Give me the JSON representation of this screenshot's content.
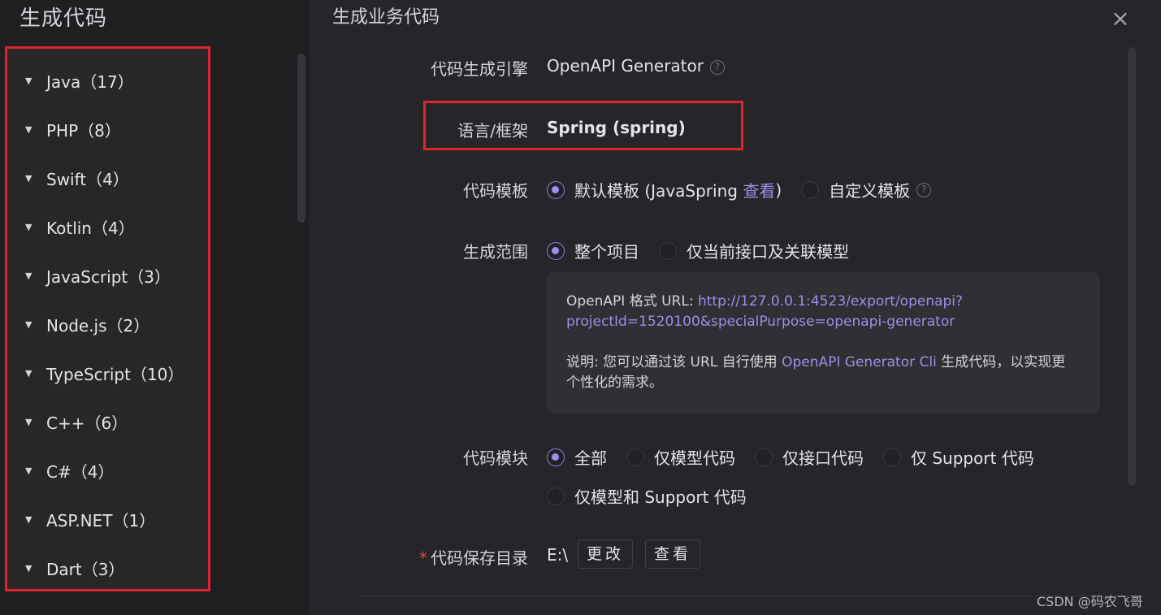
{
  "left_panel": {
    "title": "生成代码",
    "languages": [
      {
        "label": "Java（17）"
      },
      {
        "label": "PHP（8）"
      },
      {
        "label": "Swift（4）"
      },
      {
        "label": "Kotlin（4）"
      },
      {
        "label": "JavaScript（3）"
      },
      {
        "label": "Node.js（2）"
      },
      {
        "label": "TypeScript（10）"
      },
      {
        "label": "C++（6）"
      },
      {
        "label": "C#（4）"
      },
      {
        "label": "ASP.NET（1）"
      },
      {
        "label": "Dart（3）"
      }
    ]
  },
  "dialog": {
    "title": "生成业务代码",
    "close_symbol": "×",
    "engine": {
      "label": "代码生成引擎",
      "value": "OpenAPI Generator",
      "help": "?"
    },
    "language": {
      "label": "语言/框架",
      "value": "Spring (spring)"
    },
    "template": {
      "label": "代码模板",
      "option_default_prefix": "默认模板 (JavaSpring ",
      "option_default_link": "查看",
      "option_default_suffix": ")",
      "option_custom": "自定义模板",
      "selected": "default"
    },
    "scope": {
      "label": "生成范围",
      "option_project": "整个项目",
      "option_current": "仅当前接口及关联模型",
      "selected": "project"
    },
    "info": {
      "url_label": "OpenAPI 格式 URL: ",
      "url": "http://127.0.0.1:4523/export/openapi?projectId=1520100&specialPurpose=openapi-generator",
      "url_line1": "http://127.0.0.1:4523/export/openapi?",
      "url_line2": "projectId=1520100&specialPurpose=openapi-generator",
      "note_prefix": "说明: 您可以通过该 URL 自行使用 ",
      "note_link": "OpenAPI Generator Cli",
      "note_suffix_line1": " 生成代码，以实现更",
      "note_line2": "个性化的需求。"
    },
    "module": {
      "label": "代码模块",
      "option_all": "全部",
      "option_model": "仅模型代码",
      "option_api": "仅接口代码",
      "option_support": "仅 Support 代码",
      "option_model_support": "仅模型和 Support 代码",
      "selected": "all"
    },
    "save_dir": {
      "required_mark": "*",
      "label": "代码保存目录",
      "value": "E:\\",
      "change_button": "更改",
      "view_button": "查看"
    }
  },
  "watermark": "CSDN @码农飞哥",
  "colors": {
    "accent": "#9b8ff0",
    "highlight_border": "#e0242d",
    "link": "#9d8ee8"
  }
}
